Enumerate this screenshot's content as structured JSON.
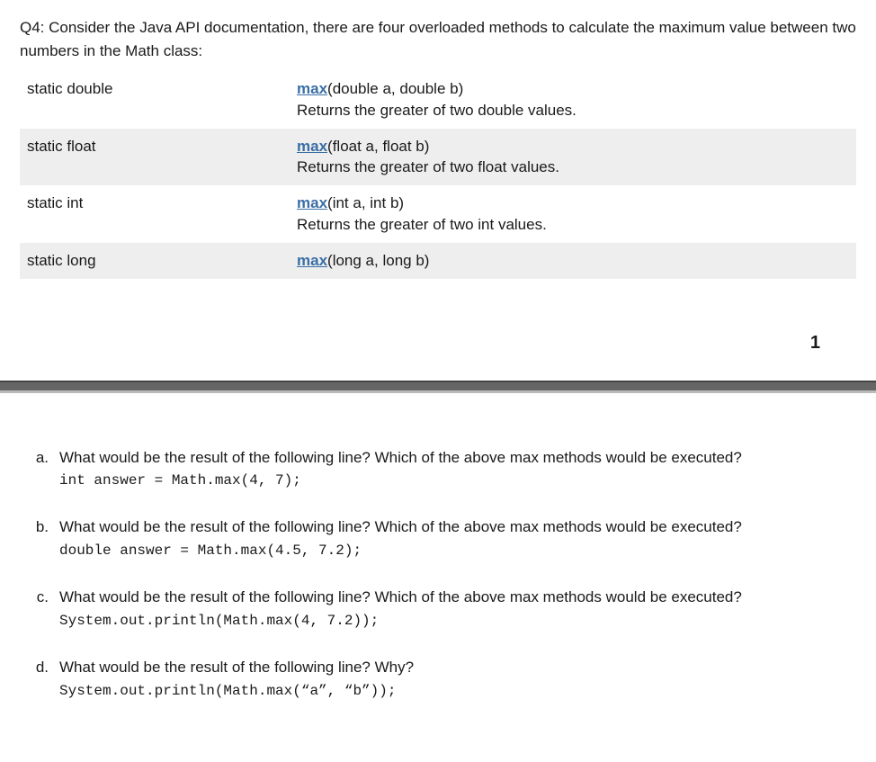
{
  "question_intro": "Q4: Consider the Java API documentation, there are four overloaded methods to calculate the maximum value between two numbers in the Math class:",
  "api_rows": [
    {
      "modifier": "static double",
      "method": "max",
      "params": "(double a, double b)",
      "desc": "Returns the greater of two double values.",
      "bg": "white"
    },
    {
      "modifier": "static float",
      "method": "max",
      "params": "(float a, float b)",
      "desc": "Returns the greater of two float values.",
      "bg": "grey"
    },
    {
      "modifier": "static int",
      "method": "max",
      "params": "(int a, int b)",
      "desc": "Returns the greater of two int values.",
      "bg": "white"
    },
    {
      "modifier": "static long",
      "method": "max",
      "params": "(long a, long b)",
      "desc": "",
      "bg": "grey"
    }
  ],
  "page_number": "1",
  "sub_questions": [
    {
      "marker": "a.",
      "text": "What would be the result of the following line? Which of the above max methods would be executed?",
      "code": "int answer = Math.max(4, 7);"
    },
    {
      "marker": "b.",
      "text": "What would be the result of the following line? Which of the above max methods would be executed?",
      "code": "double answer = Math.max(4.5, 7.2);"
    },
    {
      "marker": "c.",
      "text": "What would be the result of the following line? Which of the above max methods would be executed?",
      "code": "System.out.println(Math.max(4, 7.2));"
    },
    {
      "marker": "d.",
      "text": "What would be the result of the following line? Why?",
      "code": "System.out.println(Math.max(“a”, “b”));"
    }
  ]
}
